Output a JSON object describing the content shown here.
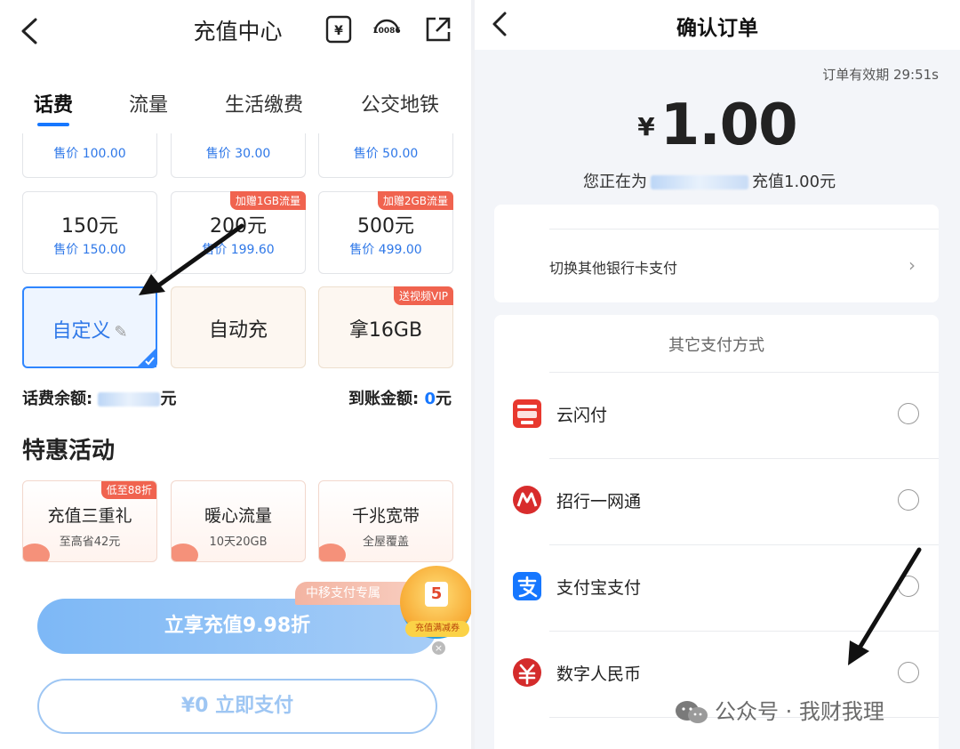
{
  "left": {
    "header": {
      "title": "充值中心",
      "icon_phone_label": "10086"
    },
    "tabs": [
      {
        "label": "话费",
        "active": true
      },
      {
        "label": "流量",
        "active": false
      },
      {
        "label": "生活缴费",
        "active": false
      },
      {
        "label": "公交地铁",
        "active": false
      }
    ],
    "top_row_prices": [
      "售价 100.00",
      "售价 30.00",
      "售价 50.00"
    ],
    "amount_cards": [
      {
        "amount": "150元",
        "price": "售价 150.00",
        "badge": ""
      },
      {
        "amount": "200元",
        "price": "售价 199.60",
        "badge": "加赠1GB流量"
      },
      {
        "amount": "500元",
        "price": "售价 499.00",
        "badge": "加赠2GB流量"
      }
    ],
    "custom_cards": [
      {
        "label": "自定义",
        "badge": "",
        "selected": true
      },
      {
        "label": "自动充",
        "badge": "",
        "selected": false
      },
      {
        "label": "拿16GB",
        "badge": "送视频VIP",
        "selected": false
      }
    ],
    "balance": {
      "label": "话费余额:",
      "suffix": "元",
      "arrival_label": "到账金额:",
      "arrival_value": "0",
      "arrival_suffix": "元"
    },
    "section_title": "特惠活动",
    "promos": [
      {
        "title": "充值三重礼",
        "subtitle": "至高省42元",
        "badge": "低至88折"
      },
      {
        "title": "暖心流量",
        "subtitle": "10天20GB",
        "badge": ""
      },
      {
        "title": "千兆宽带",
        "subtitle": "全屋覆盖",
        "badge": ""
      }
    ],
    "ribbon": "中移支付专属",
    "floaty_tag": "充值满减券",
    "floaty_num": "5",
    "main_button": "立享充值9.98折",
    "pay_button": "¥0 立即支付"
  },
  "right": {
    "title": "确认订单",
    "validity": "订单有效期 29:51s",
    "currency": "¥",
    "amount": "1.00",
    "for_prefix": "您正在为",
    "for_suffix": "充值1.00元",
    "switch_card": "切换其他银行卡支付",
    "other_methods": "其它支付方式",
    "methods": [
      {
        "name": "云闪付",
        "icon": "unionpay-quickpass-icon"
      },
      {
        "name": "招行一网通",
        "icon": "cmb-icon"
      },
      {
        "name": "支付宝支付",
        "icon": "alipay-icon"
      },
      {
        "name": "数字人民币",
        "icon": "ecny-icon"
      }
    ]
  },
  "watermark": "公众号 · 我财我理",
  "colors": {
    "accent": "#1677ff",
    "price": "#2f78e8",
    "badge": "#f0634f"
  }
}
